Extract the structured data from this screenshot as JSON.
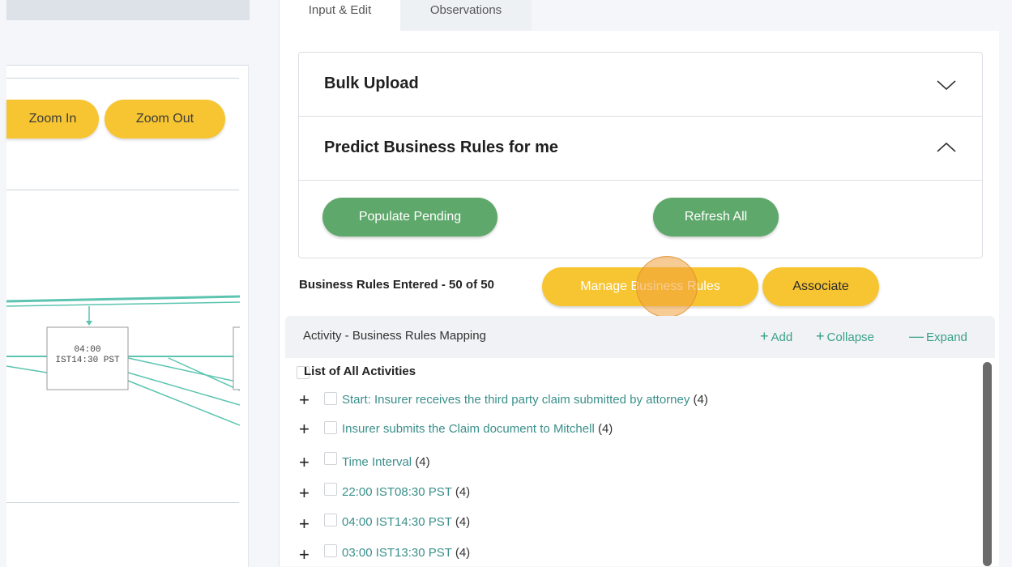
{
  "tabs": [
    {
      "label": "Input & Edit",
      "active": true
    },
    {
      "label": "Observations",
      "active": false
    }
  ],
  "canvas": {
    "zoom_in_label": "Zoom In",
    "zoom_out_label": "Zoom Out",
    "node_label_line1": "04:00",
    "node_label_line2": "IST14:30 PST"
  },
  "accordion": {
    "bulk_upload": "Bulk Upload",
    "predict": "Predict Business Rules for me",
    "populate_pending": "Populate Pending",
    "refresh_all": "Refresh All"
  },
  "business_rules": {
    "entered_label": "Business Rules Entered - 50 of 50",
    "manage_label": "Manage Business Rules",
    "associate_label": "Associate"
  },
  "mapping": {
    "title": "Activity - Business Rules Mapping",
    "add_label": "Add",
    "collapse_label": "Collapse",
    "expand_label": "Expand",
    "list_title": "List of All Activities",
    "items": [
      {
        "text": "Start: Insurer receives the third party claim submitted by attorney",
        "count": "(4)"
      },
      {
        "text": "Insurer submits the Claim document to Mitchell",
        "count": "(4)"
      },
      {
        "text": "Time Interval",
        "count": "(4)"
      },
      {
        "text": "22:00 IST08:30 PST",
        "count": "(4)"
      },
      {
        "text": "04:00 IST14:30 PST",
        "count": "(4)"
      },
      {
        "text": "03:00 IST13:30 PST",
        "count": "(4)"
      }
    ]
  },
  "colors": {
    "yellow": "#f7c531",
    "green": "#5fa86b",
    "teal": "#3aa18a"
  }
}
